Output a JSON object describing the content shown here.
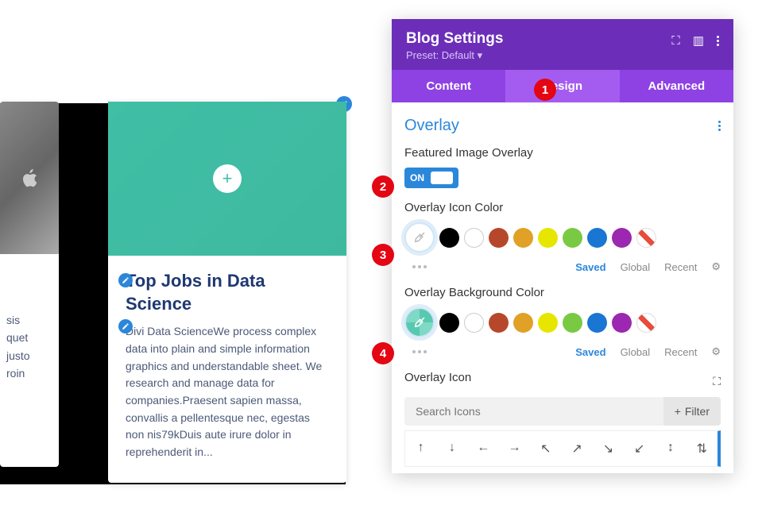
{
  "panel": {
    "title": "Blog Settings",
    "preset": "Preset: Default ▾",
    "tabs": {
      "content": "Content",
      "design": "Design",
      "advanced": "Advanced"
    }
  },
  "section": {
    "title": "Overlay",
    "fields": {
      "featured": {
        "label": "Featured Image Overlay",
        "toggle": "ON"
      },
      "iconColor": {
        "label": "Overlay Icon Color"
      },
      "bgColor": {
        "label": "Overlay Background Color"
      },
      "overlayIcon": {
        "label": "Overlay Icon",
        "searchPlaceholder": "Search Icons",
        "filter": "Filter"
      }
    },
    "tabsMini": {
      "saved": "Saved",
      "global": "Global",
      "recent": "Recent"
    }
  },
  "swatches": [
    "#000000",
    "#ffffff",
    "#b7472a",
    "#e0a126",
    "#e6e600",
    "#7ac943",
    "#1976d2",
    "#9c27b0"
  ],
  "arrows": [
    "↑",
    "↓",
    "←",
    "→",
    "↖",
    "↗",
    "↘",
    "↙",
    "↕",
    "⇅"
  ],
  "card": {
    "title": "Top Jobs in Data Science",
    "text": "Divi Data ScienceWe process complex data into plain and simple information graphics and understandable sheet. We research and manage data for companies.Praesent sapien massa, convallis a pellentesque nec, egestas non nis79kDuis aute irure dolor in reprehenderit in..."
  },
  "cardLeft": {
    "fragments": [
      "sis",
      "quet",
      "justo",
      "roin"
    ]
  },
  "annotations": {
    "a1": "1",
    "a2": "2",
    "a3": "3",
    "a4": "4"
  }
}
